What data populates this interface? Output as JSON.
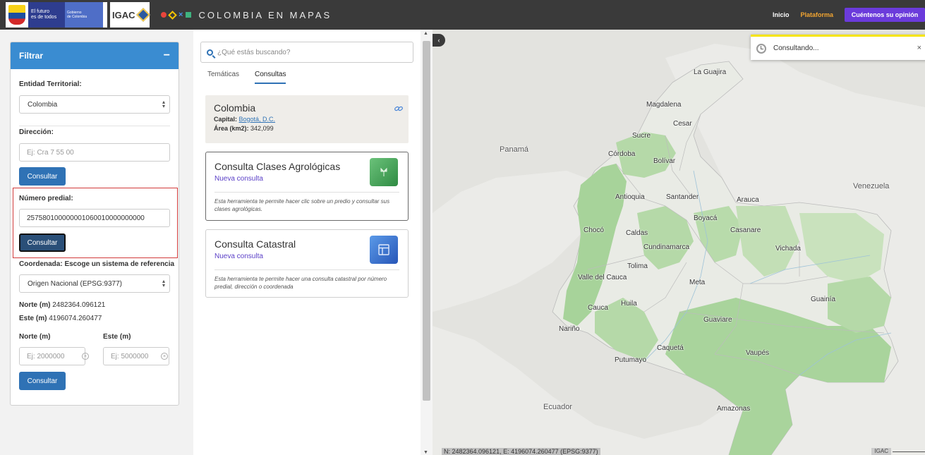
{
  "header": {
    "gov_text_line1": "El futuro",
    "gov_text_line2": "es de todos",
    "gov_text2_line1": "Gobierno",
    "gov_text2_line2": "de Colombia",
    "igac_logo": "IGAC",
    "brand_title": "COLOMBIA EN MAPAS",
    "nav_inicio": "Inicio",
    "nav_plataforma": "Plataforma",
    "feedback_button": "Cuéntenos su opinión"
  },
  "filter": {
    "title": "Filtrar",
    "collapse_symbol": "−",
    "entidad_label": "Entidad Territorial:",
    "entidad_value": "Colombia",
    "direccion_label": "Dirección:",
    "direccion_placeholder": "Ej: Cra 7 55 00",
    "consultar": "Consultar",
    "predial_label": "Número predial:",
    "predial_value": "257580100000001060010000000000",
    "coordenada_label": "Coordenada: Escoge un sistema de referencia",
    "sistema_value": "Origen Nacional (EPSG:9377)",
    "norte_label": "Norte (m)",
    "norte_value": "2482364.096121",
    "este_label": "Este (m)",
    "este_value": "4196074.260477",
    "norte_input_label": "Norte (m)",
    "este_input_label": "Este (m)",
    "norte_placeholder": "Ej: 2000000",
    "este_placeholder": "Ej: 5000000"
  },
  "middle": {
    "search_placeholder": "¿Qué estás buscando?",
    "tabs": [
      {
        "label": "Temáticas"
      },
      {
        "label": "Consultas"
      }
    ],
    "info": {
      "title": "Colombia",
      "capital_label": "Capital:",
      "capital_value": "Bogotá, D.C.",
      "area_label": "Área (km2):",
      "area_value": "342,099"
    },
    "tools": [
      {
        "title": "Consulta Clases Agrológicas",
        "subtitle": "Nueva consulta",
        "description": "Esta herramienta te permite hacer clic sobre un predio y consultar sus clases agrológicas."
      },
      {
        "title": "Consulta Catastral",
        "subtitle": "Nueva consulta",
        "description": "Esta herramienta te permite hacer una consulta catastral por número predial, dirección o coordenada"
      }
    ]
  },
  "map": {
    "toast_text": "Consultando...",
    "toast_close": "×",
    "coords_text": "N: 2482364.096121, E: 4196074.260477 (EPSG:9377)",
    "attribution": "IGAC",
    "places": {
      "la_guajira": "La Guajira",
      "magdalena": "Magdalena",
      "cesar": "Cesar",
      "sucre": "Sucre",
      "panama": "Panamá",
      "cordoba": "Córdoba",
      "bolivar": "Bolívar",
      "venezuela": "Venezuela",
      "antioquia": "Antioquia",
      "santander": "Santander",
      "arauca": "Arauca",
      "boyaca": "Boyacá",
      "casanare": "Casanare",
      "choco": "Chocó",
      "caldas": "Caldas",
      "cundinamarca": "Cundinamarca",
      "vichada": "Vichada",
      "tolima": "Tolima",
      "valle": "Valle del Cauca",
      "meta": "Meta",
      "guainia": "Guainía",
      "cauca": "Cauca",
      "huila": "Huila",
      "guaviare": "Guaviare",
      "narino": "Nariño",
      "caqueta": "Caquetá",
      "vaupes": "Vaupés",
      "putumayo": "Putumayo",
      "ecuador": "Ecuador",
      "amazonas": "Amazonas"
    }
  }
}
